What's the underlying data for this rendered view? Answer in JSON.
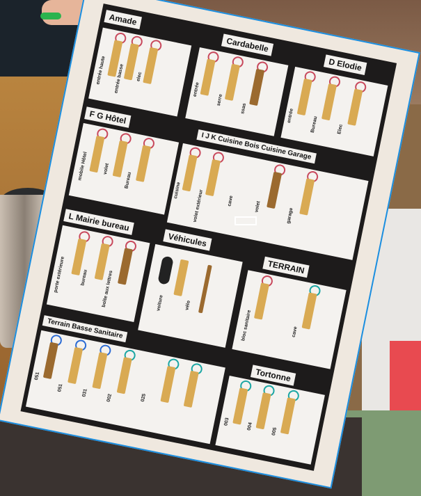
{
  "scene": "key board",
  "sections": [
    {
      "label": "Amade",
      "slots": [
        "entrée haute",
        "entrée basse",
        "elec"
      ]
    },
    {
      "label": "Cardabelle",
      "slots": [
        "entrée",
        "serre",
        "ssas"
      ]
    },
    {
      "label": "D Elodie",
      "slots": [
        "entrée",
        "Bureau",
        "Elec"
      ]
    },
    {
      "label": "F G Hôtel",
      "slots": [
        "mobile Hôtel",
        "volet",
        "Bureau"
      ]
    },
    {
      "label": "I J K Cuisine Bois Cuisine Garage",
      "slots": [
        "cuisine",
        "volet extérieur",
        "cave",
        "volet",
        "garage"
      ]
    },
    {
      "label": "L Mairie bureau",
      "slots": [
        "porte extérieure",
        "bureau",
        "boîte aux lettres"
      ]
    },
    {
      "label": "Véhicules",
      "slots": [
        "voiture",
        "vélo"
      ]
    },
    {
      "label": "TERRAIN",
      "slots": [
        "bloc sanitaire",
        "cave"
      ]
    },
    {
      "label": "Terrain Basse Sanitaire",
      "slots": [
        "051",
        "051",
        "031",
        "002",
        "025"
      ]
    },
    {
      "label": "Tortonne",
      "slots": [
        "003",
        "004",
        "005"
      ]
    }
  ],
  "colors": {
    "board": "#1d1b1b",
    "paper": "#f4f2ef",
    "tag": "#d9aa53",
    "frame_border": "#1a8ee0",
    "ring_red": "#c8485c",
    "ring_blue": "#2b6bd4"
  }
}
